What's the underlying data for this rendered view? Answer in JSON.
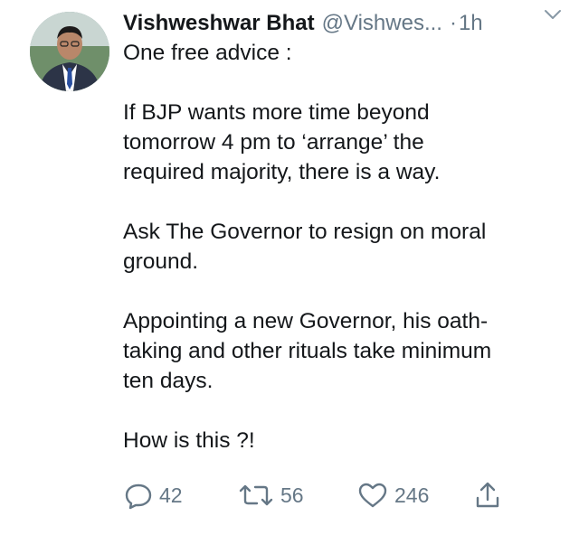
{
  "tweet": {
    "author_name": "Vishweshwar Bhat",
    "handle": "@Vishwes...",
    "separator": "·",
    "time": "1h",
    "lines": [
      "One free advice :",
      "",
      "If BJP wants more time beyond",
      "tomorrow 4 pm to ‘arrange’ the",
      "required majority, there is a way.",
      "",
      "Ask The Governor to resign on moral",
      "ground.",
      "",
      "Appointing a new Governor, his oath-",
      "taking and other rituals take minimum",
      "ten days.",
      "",
      "How is this ?!"
    ]
  },
  "actions": {
    "reply_count": "42",
    "retweet_count": "56",
    "like_count": "246"
  },
  "icons": {
    "caret": "chevron-down-icon",
    "reply": "reply-icon",
    "retweet": "retweet-icon",
    "like": "heart-icon",
    "share": "share-icon"
  },
  "colors": {
    "text": "#14171a",
    "muted": "#657786"
  }
}
